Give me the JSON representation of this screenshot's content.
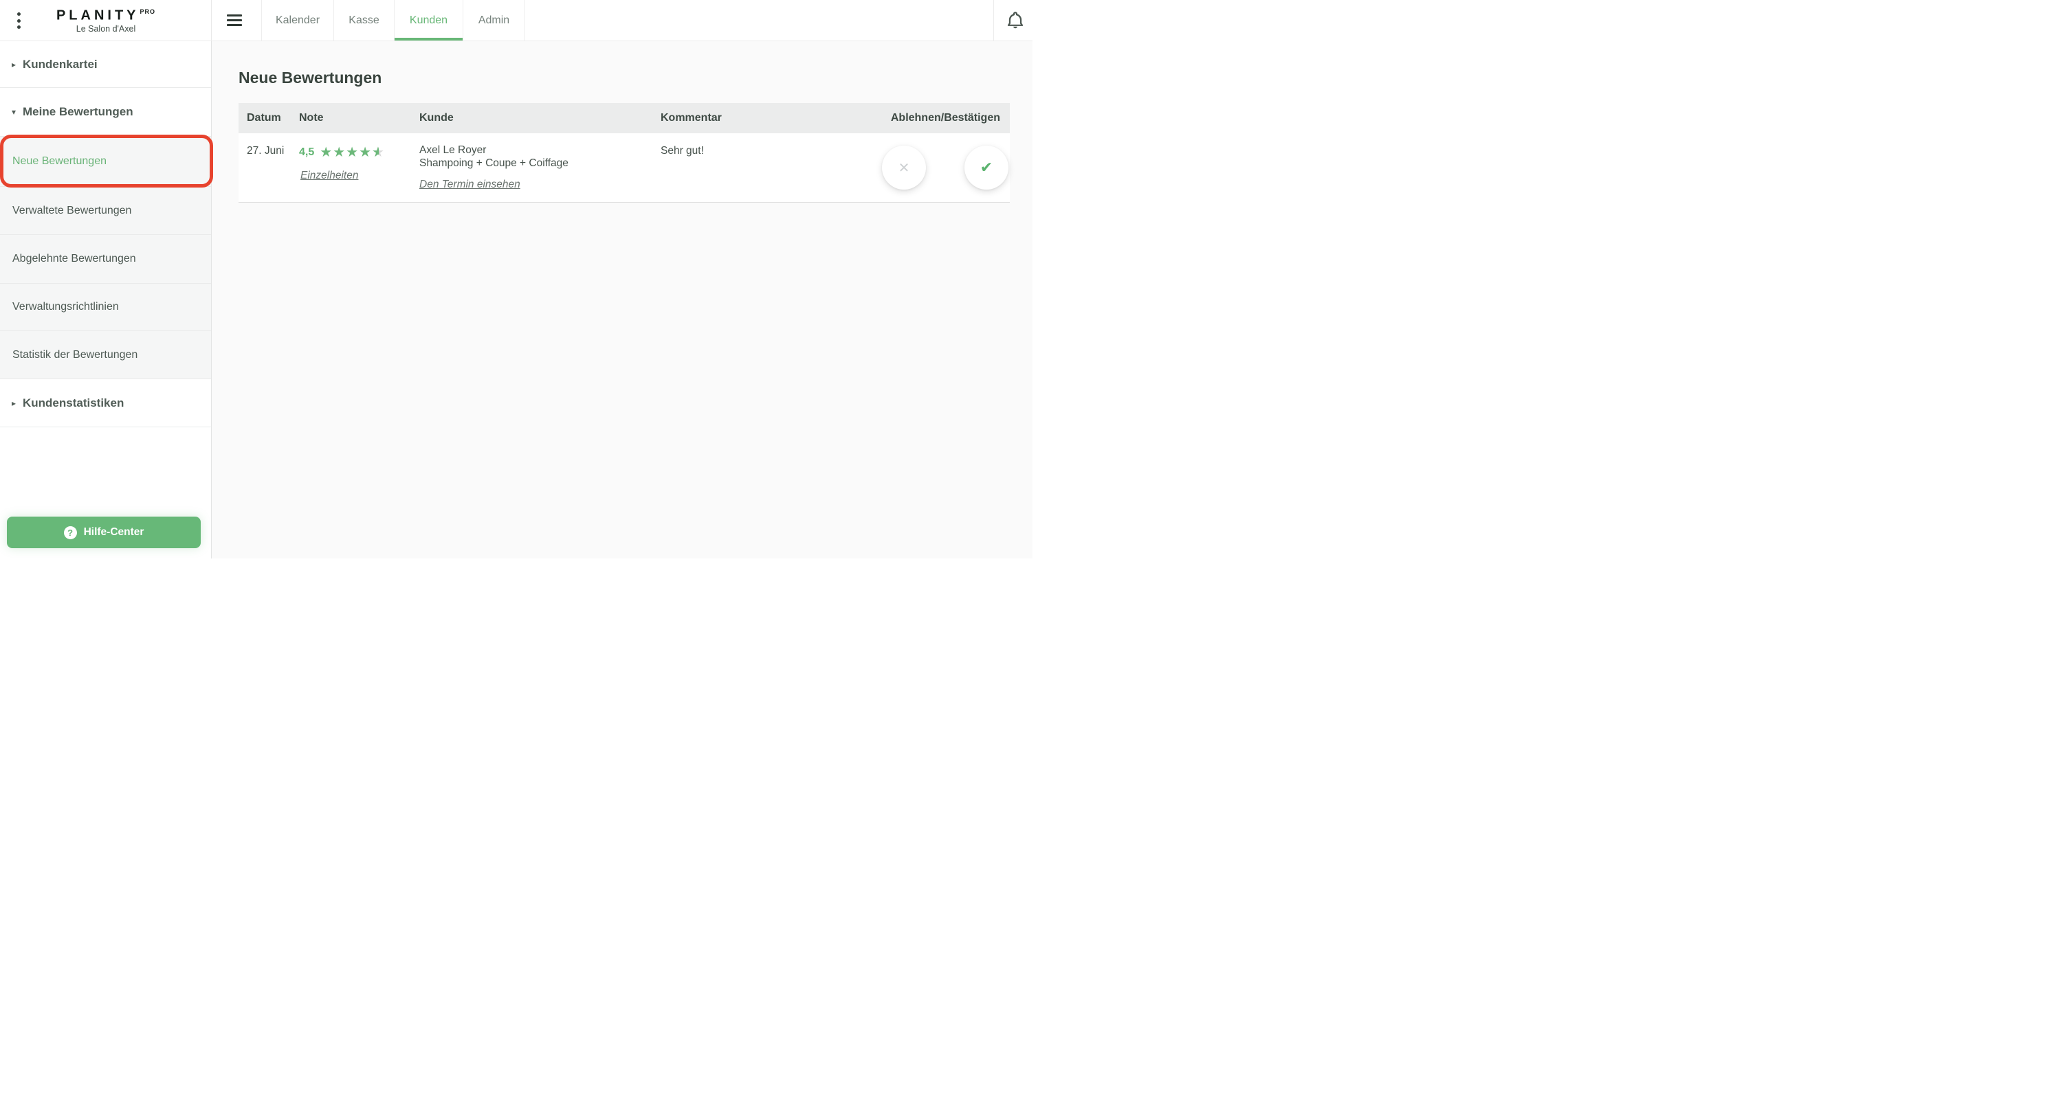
{
  "topbar": {
    "logo": "PLANITY",
    "logo_badge": "PRO",
    "salon": "Le Salon d'Axel",
    "tabs": [
      {
        "label": "Kalender",
        "active": false
      },
      {
        "label": "Kasse",
        "active": false
      },
      {
        "label": "Kunden",
        "active": true
      },
      {
        "label": "Admin",
        "active": false
      }
    ]
  },
  "sidebar": {
    "groups": [
      {
        "label": "Kundenkartei",
        "expanded": false
      },
      {
        "label": "Meine Bewertungen",
        "expanded": true
      },
      {
        "label": "Kundenstatistiken",
        "expanded": false
      }
    ],
    "review_items": [
      {
        "label": "Neue Bewertungen",
        "active": true
      },
      {
        "label": "Verwaltete Bewertungen",
        "active": false
      },
      {
        "label": "Abgelehnte Bewertungen",
        "active": false
      },
      {
        "label": "Verwaltungsrichtlinien",
        "active": false
      },
      {
        "label": "Statistik der Bewertungen",
        "active": false
      }
    ]
  },
  "help": {
    "label": "Hilfe-Center"
  },
  "main": {
    "title": "Neue Bewertungen",
    "table": {
      "headers": [
        "Datum",
        "Note",
        "Kunde",
        "Kommentar",
        "Ablehnen/Bestätigen"
      ],
      "rows": [
        {
          "date": "27. Juni",
          "rating_display": "4,5",
          "rating_value": 4.5,
          "rating_max": 5,
          "details_link": "Einzelheiten",
          "customer_name": "Axel Le Royer",
          "service": "Shampoing + Coupe + Coiffage",
          "appointment_link": "Den Termin einsehen",
          "comment": "Sehr gut!"
        }
      ]
    }
  },
  "icons": {
    "kebab_menu": "kebab-menu-icon",
    "hamburger_menu": "hamburger-menu-icon",
    "bell": "notification-bell-icon",
    "arrow_collapsed": "▸",
    "arrow_expanded": "▾",
    "rating_star": "★",
    "cross": "✕",
    "check": "✔",
    "help": "?"
  },
  "colors": {
    "accent_green": "#68b777",
    "star_green": "#6cb87a",
    "star_empty": "#d9d9d9",
    "annotation_red": "#e7432e",
    "check_green": "#5bb36e",
    "cross_gray": "#ced1d3",
    "sidebar_item_bg": "#f5f6f6",
    "table_header_bg": "#ebecec",
    "main_bg": "#fafafa"
  }
}
